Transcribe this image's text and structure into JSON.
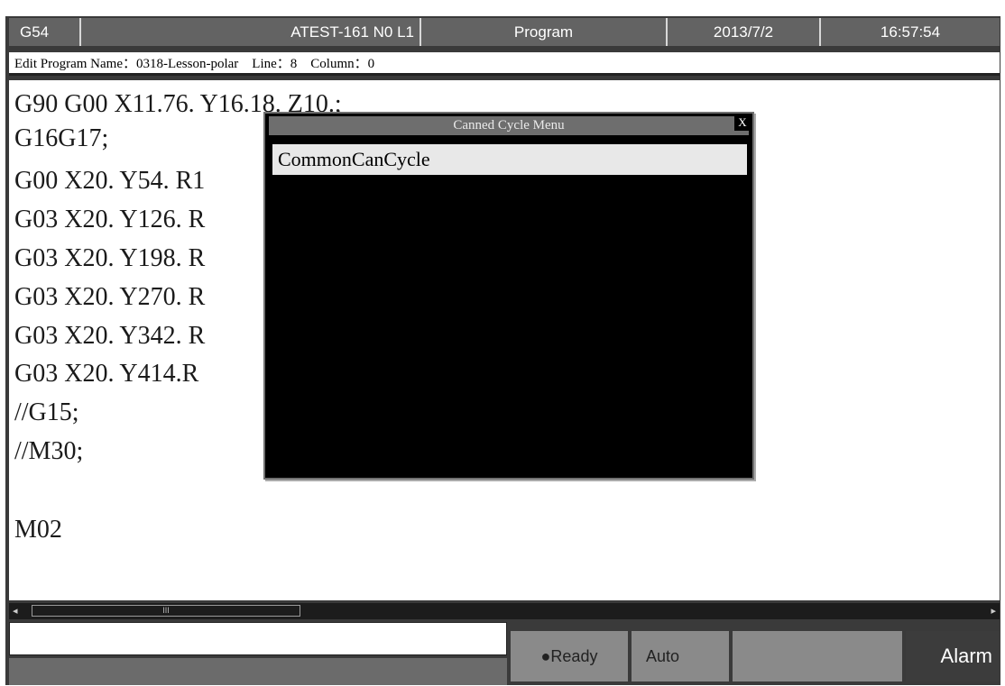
{
  "topbar": {
    "coord": "G54",
    "program_id": "ATEST-161 N0 L1",
    "mode": "Program",
    "date": "2013/7/2",
    "time": "16:57:54"
  },
  "info": {
    "program_name_label": "Edit Program Name：",
    "program_name": "0318-Lesson-polar",
    "line_label": "Line：",
    "line": "8",
    "column_label": "Column：",
    "column": "0"
  },
  "code_lines": [
    "G90 G00 X11.76. Y16.18. Z10.;",
    "G16G17;",
    "G00 X20. Y54. R1",
    "G03 X20. Y126. R",
    "G03 X20. Y198. R",
    "G03 X20. Y270. R",
    "G03 X20. Y342. R",
    "G03 X20. Y414.R",
    "//G15;",
    "//M30;",
    "",
    "M02"
  ],
  "dialog": {
    "title": "Canned Cycle Menu",
    "close_label": "X",
    "items": [
      "CommonCanCycle"
    ]
  },
  "scrollbar": {
    "thumb_grip": "III"
  },
  "status": {
    "ready": "●Ready",
    "auto": "Auto",
    "alarm": "Alarm"
  }
}
